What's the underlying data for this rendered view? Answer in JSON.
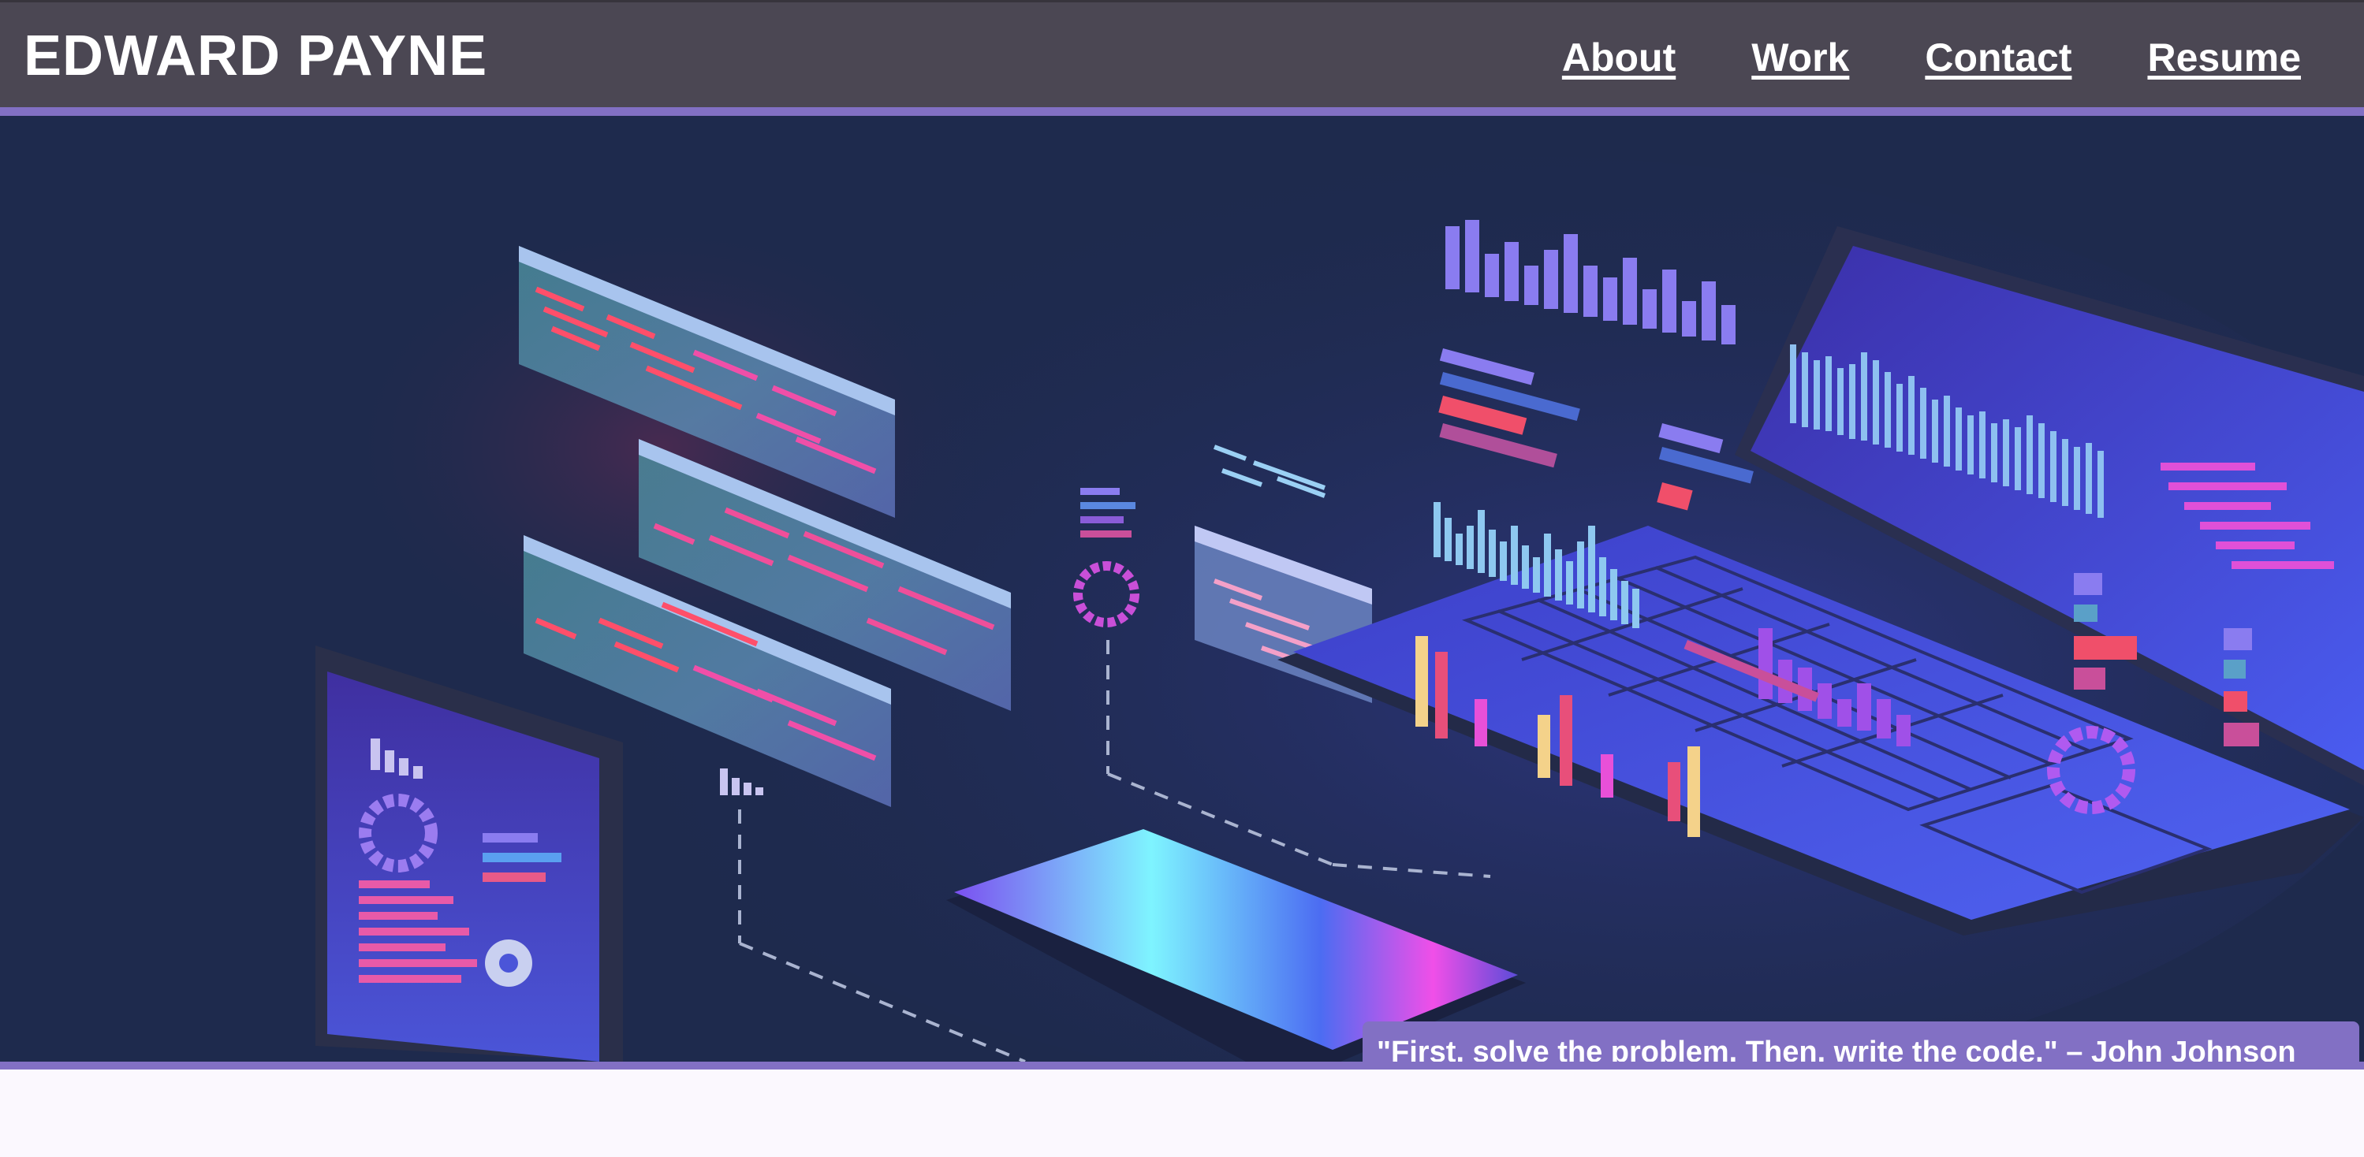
{
  "header": {
    "brand": "EDWARD PAYNE",
    "nav": [
      {
        "label": "About"
      },
      {
        "label": "Work"
      },
      {
        "label": "Contact"
      },
      {
        "label": "Resume"
      }
    ]
  },
  "hero": {
    "quote": "\"First, solve the problem. Then, write the code.\" – John Johnson",
    "illustration": "isometric-tech-dashboard-illustration"
  },
  "colors": {
    "header_bg": "#4b4753",
    "accent": "#8270c4",
    "hero_bg": "#1e2a4d",
    "page_bg": "#fbf8fe"
  }
}
